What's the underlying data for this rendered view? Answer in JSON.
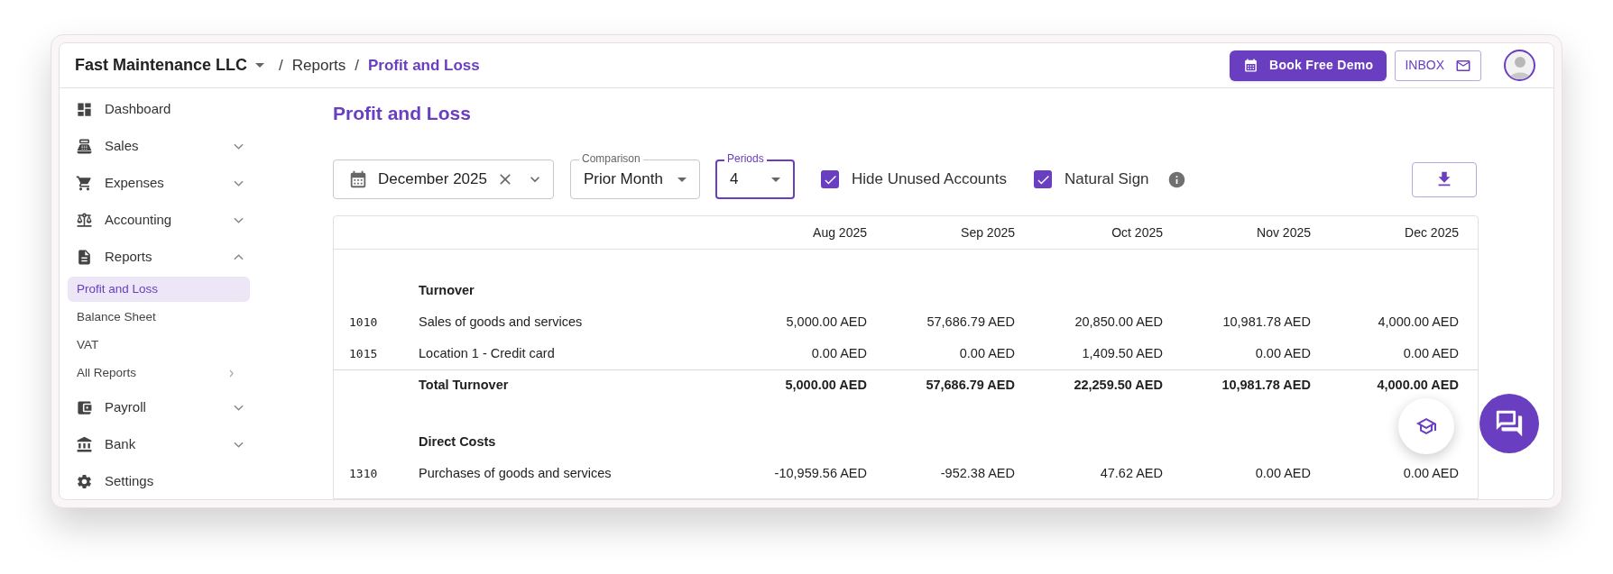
{
  "header": {
    "company": "Fast Maintenance LLC",
    "breadcrumbs": [
      {
        "separator": "/",
        "label": "Reports",
        "current": false
      },
      {
        "separator": "/",
        "label": "Profit and Loss",
        "current": true
      }
    ],
    "demo_button": "Book Free Demo",
    "inbox_button": "INBOX"
  },
  "sidebar": {
    "items": [
      {
        "label": "Dashboard"
      },
      {
        "label": "Sales",
        "expanded": false
      },
      {
        "label": "Expenses",
        "expanded": false
      },
      {
        "label": "Accounting",
        "expanded": false
      },
      {
        "label": "Reports",
        "expanded": true,
        "children": [
          {
            "label": "Profit and Loss",
            "selected": true
          },
          {
            "label": "Balance Sheet",
            "selected": false
          },
          {
            "label": "VAT",
            "selected": false
          },
          {
            "label": "All Reports",
            "selected": false,
            "submenu": true
          }
        ]
      },
      {
        "label": "Payroll",
        "expanded": false
      },
      {
        "label": "Bank",
        "expanded": false
      },
      {
        "label": "Settings"
      }
    ]
  },
  "page_title": "Profit and Loss",
  "filters": {
    "date": {
      "value": "December 2025"
    },
    "comparison": {
      "label": "Comparison",
      "value": "Prior Month",
      "focused": false
    },
    "periods": {
      "label": "Periods",
      "value": "4",
      "focused": true
    },
    "checkboxes": [
      {
        "label": "Hide Unused Accounts",
        "checked": true
      },
      {
        "label": "Natural Sign",
        "checked": true,
        "info": true
      }
    ]
  },
  "table": {
    "columns": [
      "Aug 2025",
      "Sep 2025",
      "Oct 2025",
      "Nov 2025",
      "Dec 2025"
    ],
    "rows": [
      {
        "kind": "section",
        "name": "Turnover"
      },
      {
        "kind": "account",
        "code": "1010",
        "name": "Sales of goods and services",
        "values": [
          "5,000.00 AED",
          "57,686.79 AED",
          "20,850.00 AED",
          "10,981.78 AED",
          "4,000.00 AED"
        ]
      },
      {
        "kind": "account",
        "code": "1015",
        "name": "Location 1 - Credit card",
        "values": [
          "0.00 AED",
          "0.00 AED",
          "1,409.50 AED",
          "0.00 AED",
          "0.00 AED"
        ]
      },
      {
        "kind": "total",
        "name": "Total Turnover",
        "values": [
          "5,000.00 AED",
          "57,686.79 AED",
          "22,259.50 AED",
          "10,981.78 AED",
          "4,000.00 AED"
        ]
      },
      {
        "kind": "section",
        "name": "Direct Costs"
      },
      {
        "kind": "account",
        "code": "1310",
        "name": "Purchases of goods and services",
        "values": [
          "-10,959.56 AED",
          "-952.38 AED",
          "47.62 AED",
          "0.00 AED",
          "0.00 AED"
        ]
      }
    ]
  }
}
